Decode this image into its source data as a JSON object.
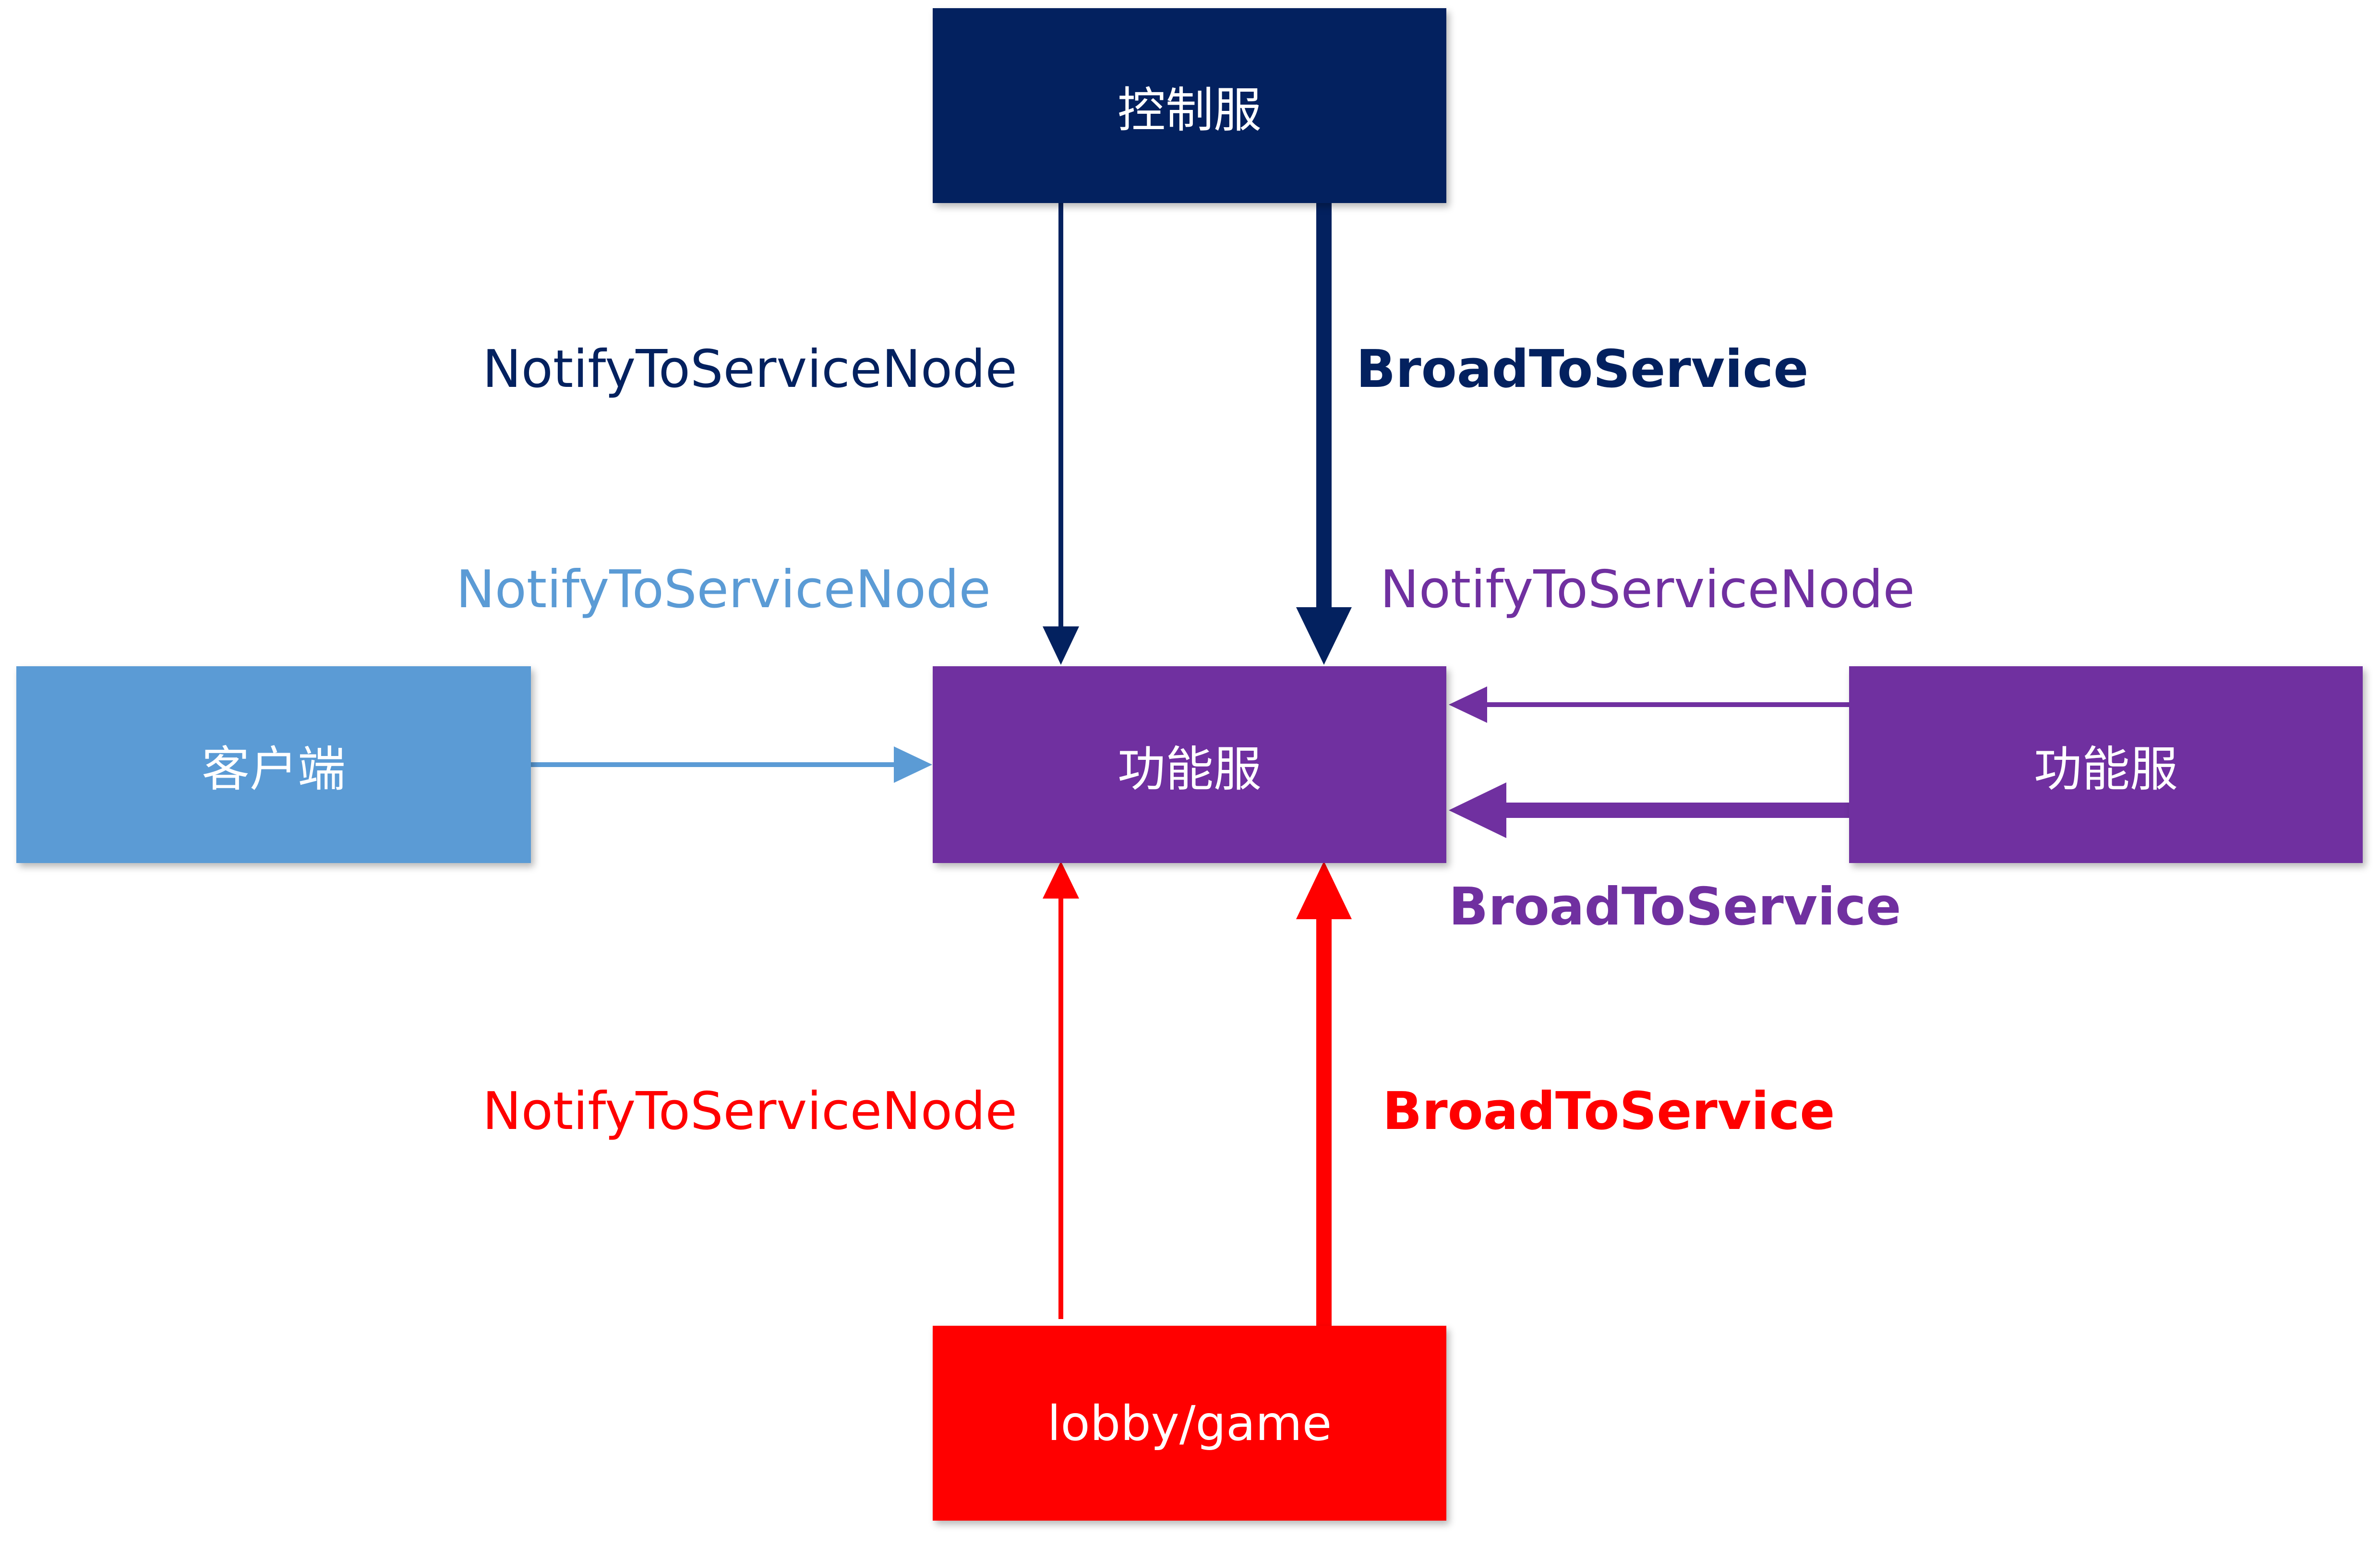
{
  "colors": {
    "control": "#03215f",
    "client": "#5b9bd5",
    "function": "#7030a0",
    "lobby": "#ff0000"
  },
  "nodes": {
    "control_server": "控制服",
    "client": "客户端",
    "function_server_center": "功能服",
    "function_server_right": "功能服",
    "lobby_game": "lobby/game"
  },
  "labels": {
    "control_notify": "NotifyToServiceNode",
    "control_broad": "BroadToService",
    "client_notify": "NotifyToServiceNode",
    "function_notify": "NotifyToServiceNode",
    "function_broad": "BroadToService",
    "lobby_notify": "NotifyToServiceNode",
    "lobby_broad": "BroadToService"
  }
}
